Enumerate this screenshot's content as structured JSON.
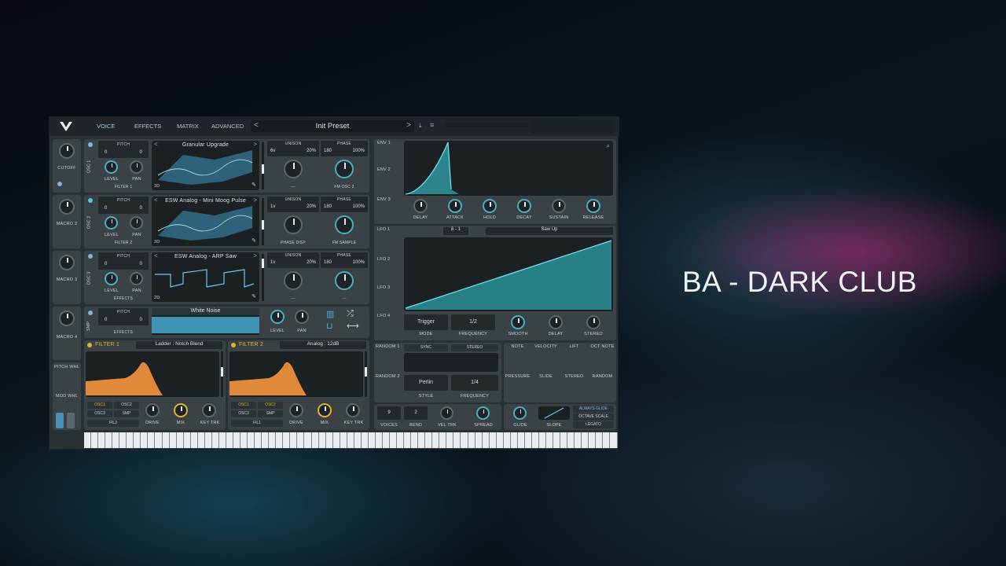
{
  "overlay_title": "BA - DARK CLUB",
  "header": {
    "tabs": [
      "VOICE",
      "EFFECTS",
      "MATRIX",
      "ADVANCED"
    ],
    "preset": "Init Preset"
  },
  "macros": [
    "CUTOFF",
    "MACRO 2",
    "MACRO 3",
    "MACRO 4"
  ],
  "wheels": [
    "PITCH WHL",
    "MOD WHL"
  ],
  "osc": [
    {
      "label": "OSC 1",
      "pitch": "PITCH",
      "p1": "0",
      "p2": "0",
      "wave": "Granular Upgrade",
      "dim": "3D",
      "unison": "UNISON",
      "voices": "6v",
      "detune": "20%",
      "phase_lbl": "PHASE",
      "phase": "180",
      "phase_pct": "100%",
      "level": "LEVEL",
      "pan": "PAN",
      "dest": "FILTER 1",
      "k1": "---",
      "k2": "FM OSC 2"
    },
    {
      "label": "OSC 2",
      "pitch": "PITCH",
      "p1": "0",
      "p2": "0",
      "wave": "ESW Analog - Mini Moog Pulse",
      "dim": "3D",
      "unison": "UNISON",
      "voices": "1v",
      "detune": "20%",
      "phase_lbl": "PHASE",
      "phase": "180",
      "phase_pct": "100%",
      "level": "LEVEL",
      "pan": "PAN",
      "dest": "FILTER 2",
      "k1": "PHASE DISP",
      "k2": "FM SAMPLE"
    },
    {
      "label": "OSC 3",
      "pitch": "PITCH",
      "p1": "0",
      "p2": "0",
      "wave": "ESW Analog - ARP Saw",
      "dim": "2D",
      "unison": "UNISON",
      "voices": "1v",
      "detune": "20%",
      "phase_lbl": "PHASE",
      "phase": "180",
      "phase_pct": "100%",
      "level": "LEVEL",
      "pan": "PAN",
      "dest": "EFFECTS",
      "k1": "---",
      "k2": "---"
    }
  ],
  "smp": {
    "label": "SMP",
    "pitch": "PITCH",
    "p1": "0",
    "p2": "0",
    "name": "White Noise",
    "level": "LEVEL",
    "pan": "PAN",
    "dest": "EFFECTS"
  },
  "filters": [
    {
      "name": "FILTER 1",
      "model": "Ladder : Notch Blend",
      "tags": [
        "OSC1",
        "OSC2",
        "OSC3",
        "SMP"
      ],
      "fil": "FIL2",
      "drive": "DRIVE",
      "mix": "MIX",
      "keytrk": "KEY TRK"
    },
    {
      "name": "FILTER 2",
      "model": "Analog : 12dB",
      "tags": [
        "OSC1",
        "OSC2",
        "OSC3",
        "SMP"
      ],
      "fil": "FIL1",
      "drive": "DRIVE",
      "mix": "MIX",
      "keytrk": "KEY TRK"
    }
  ],
  "env": {
    "tabs": [
      "ENV 1",
      "ENV 2",
      "ENV 3"
    ],
    "knobs": [
      "DELAY",
      "ATTACK",
      "HOLD",
      "DECAY",
      "SUSTAIN",
      "RELEASE"
    ]
  },
  "lfo": {
    "tabs": [
      "LFO 1",
      "LFO 2",
      "LFO 3",
      "LFO 4"
    ],
    "grid": "8 - 1",
    "shape": "Saw Up",
    "mode_val": "Trigger",
    "mode": "MODE",
    "freq_val": "1/2",
    "freq": "FREQUENCY",
    "k": [
      "SMOOTH",
      "DELAY",
      "STEREO"
    ]
  },
  "random": {
    "tabs": [
      "RANDOM 1",
      "RANDOM 2"
    ],
    "sync": "SYNC",
    "stereo": "STEREO",
    "style_val": "Perlin",
    "style": "STYLE",
    "freq_val": "1/4",
    "freq": "FREQUENCY"
  },
  "mods": [
    "NOTE",
    "VELOCITY",
    "LIFT",
    "OCT NOTE",
    "PRESSURE",
    "SLIDE",
    "STEREO",
    "RANDOM"
  ],
  "voice": {
    "voices_val": "9",
    "voices": "VOICES",
    "bend_val": "2",
    "bend": "BEND",
    "veltrk": "VEL TRK",
    "spread": "SPREAD",
    "glide": "GLIDE",
    "slope": "SLOPE",
    "always": "ALWAYS GLIDE",
    "octave": "OCTAVE SCALE",
    "legato": "LEGATO"
  },
  "colors": {
    "accent": "#4ab0c0",
    "filter": "#e0893a",
    "knob_yellow": "#e0b32b"
  }
}
